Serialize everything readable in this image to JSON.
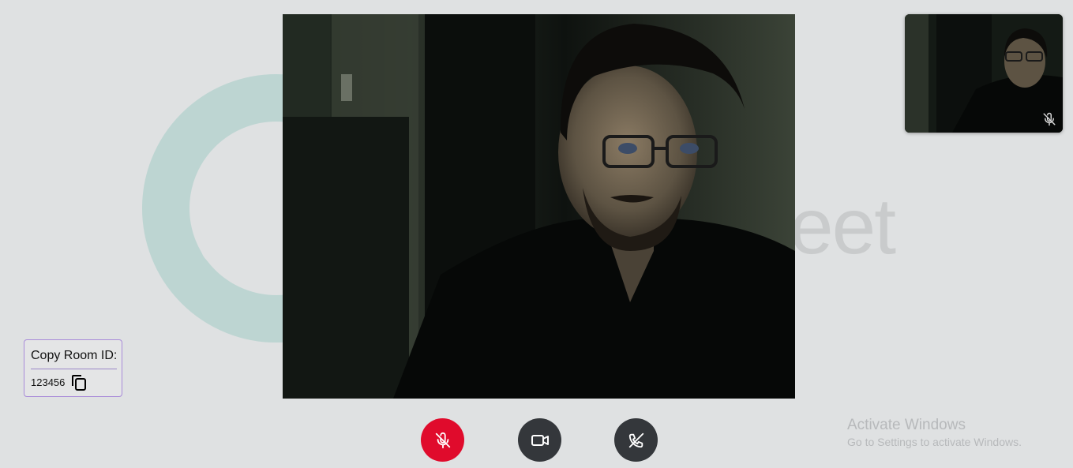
{
  "background": {
    "brand_word": "eet",
    "ring_color": "#bdd5d2"
  },
  "main_video": {
    "description_colors": [
      "#0d110e",
      "#1e2620",
      "#3a4236"
    ]
  },
  "self_preview": {
    "mic_status_icon": "mic-off-icon"
  },
  "room": {
    "label": "Copy Room ID:",
    "id": "123456",
    "copy_icon": "copy-icon"
  },
  "controls": {
    "mic": {
      "icon": "mic-off-icon",
      "color": "#e00b2c"
    },
    "camera": {
      "icon": "video-camera-icon",
      "color": "#34373b"
    },
    "end_call": {
      "icon": "phone-hangup-icon",
      "color": "#34373b"
    }
  },
  "os_watermark": {
    "title": "Activate Windows",
    "subtitle": "Go to Settings to activate Windows."
  }
}
